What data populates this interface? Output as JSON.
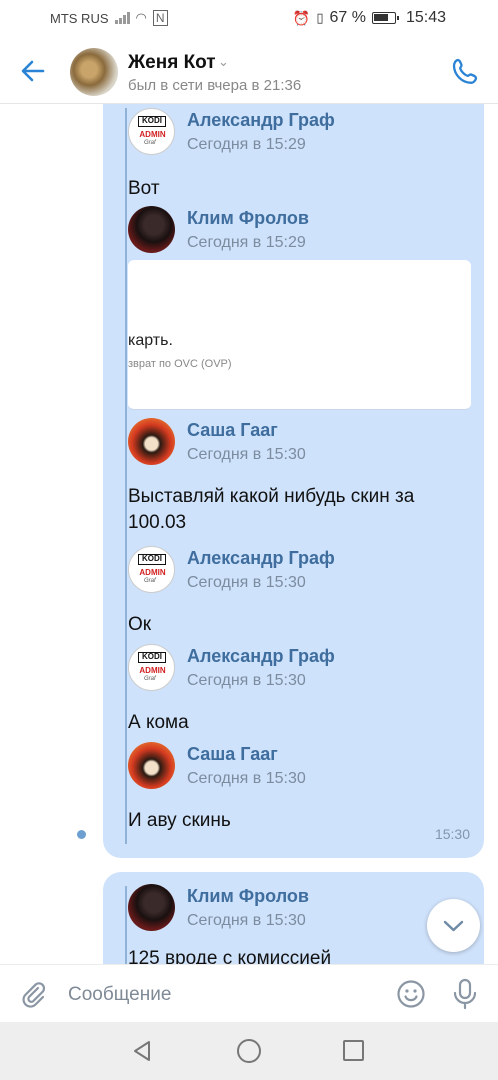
{
  "status_bar": {
    "carrier": "MTS RUS",
    "battery": "67 %",
    "time": "15:43"
  },
  "header": {
    "contact_name": "Женя Кот",
    "last_seen": "был в сети вчера в 21:36"
  },
  "messages": [
    {
      "sender": "Александр Граф",
      "time": "Сегодня в 15:29",
      "text": "Вот",
      "avatar": "kodi"
    },
    {
      "sender": "Клим Фролов",
      "time": "Сегодня в 15:29",
      "text": "",
      "avatar": "klim",
      "link_card": {
        "title": "карть.",
        "subtitle": "зврат по OVC (OVP)"
      }
    },
    {
      "sender": "Саша Гааг",
      "time": "Сегодня в 15:30",
      "text": "Выставляй какой нибудь скин за 100.03",
      "avatar": "sasha"
    },
    {
      "sender": "Александр Граф",
      "time": "Сегодня в 15:30",
      "text": "Ок",
      "avatar": "kodi"
    },
    {
      "sender": "Александр Граф",
      "time": "Сегодня в 15:30",
      "text": "А кома",
      "avatar": "kodi"
    },
    {
      "sender": "Саша Гааг",
      "time": "Сегодня в 15:30",
      "text": "И аву скинь",
      "avatar": "sasha"
    },
    {
      "sender": "Клим Фролов",
      "time": "Сегодня в 15:30",
      "text": "125 вроде с комиссией",
      "avatar": "klim"
    }
  ],
  "bubble_time": "15:30",
  "avatar_kodi": {
    "line1": "KODI",
    "line2": "ADMIN",
    "line3": "Graf"
  },
  "composer": {
    "placeholder": "Сообщение"
  },
  "colors": {
    "accent": "#2a83d4",
    "bubble": "#cfe2fb",
    "sender": "#3f6e9e"
  }
}
